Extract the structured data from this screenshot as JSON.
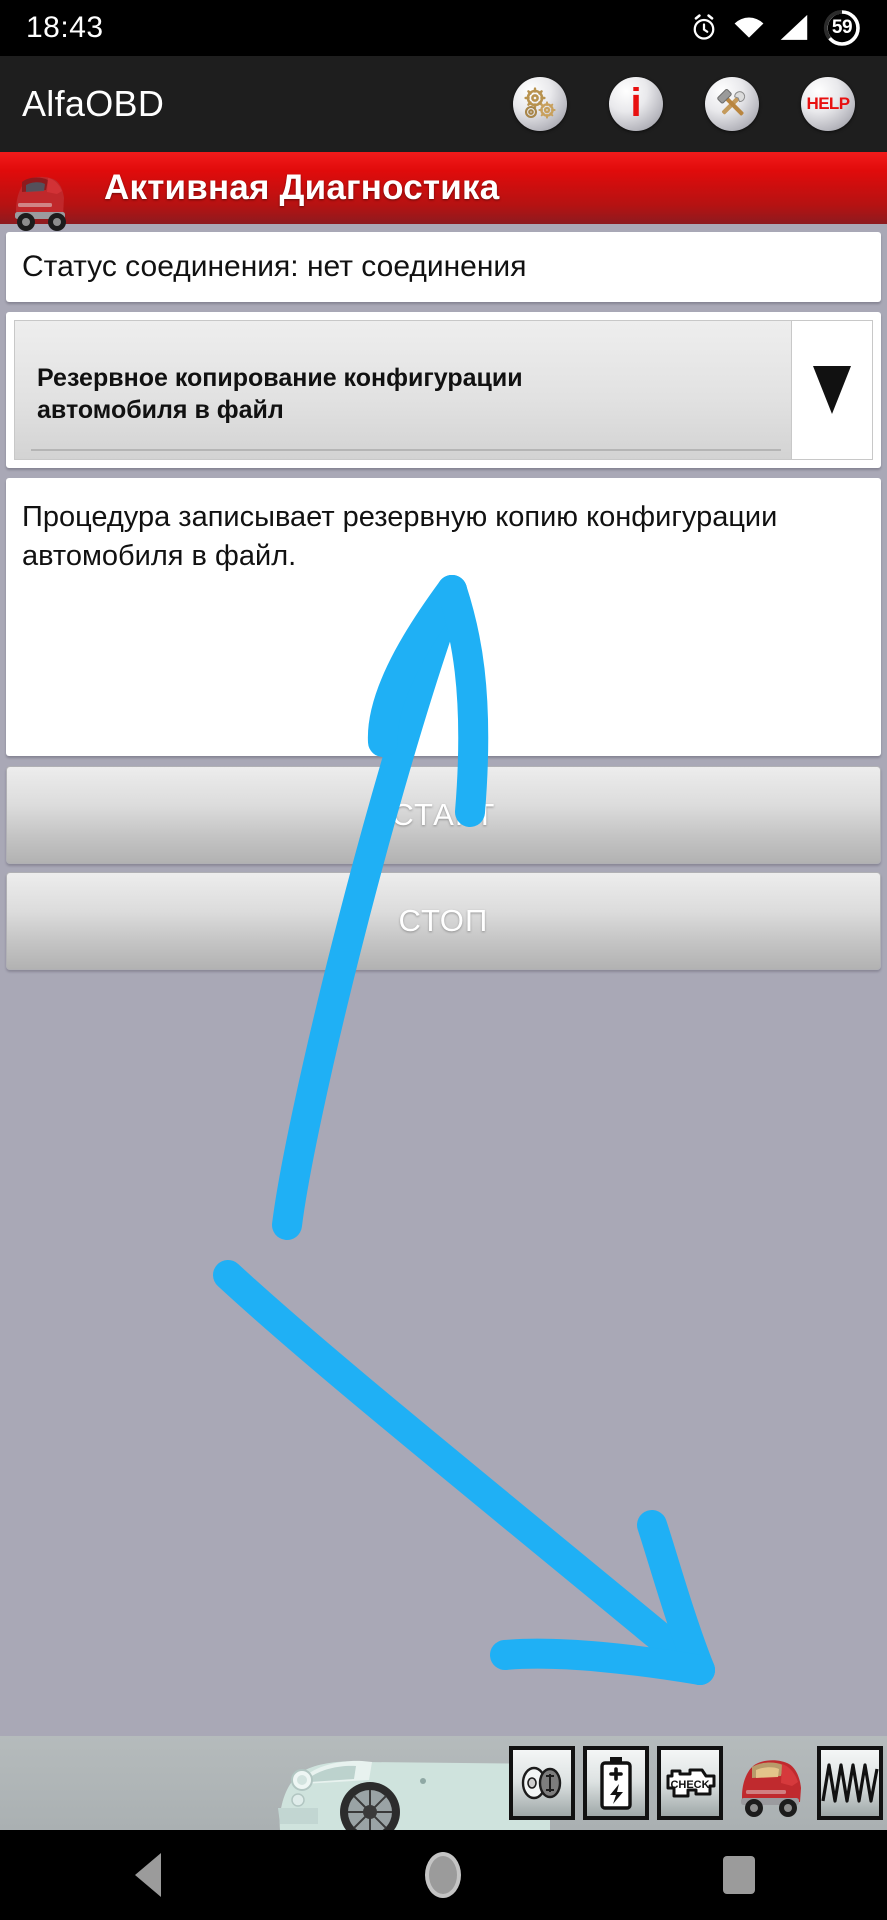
{
  "status_bar": {
    "time": "18:43",
    "icons": [
      "alarm-icon",
      "wifi-icon",
      "signal-icon"
    ],
    "battery_percent": "59"
  },
  "app_header": {
    "title": "AlfaOBD",
    "actions": [
      {
        "name": "gears-icon",
        "label": ""
      },
      {
        "name": "info-icon",
        "label": "i"
      },
      {
        "name": "tools-icon",
        "label": ""
      },
      {
        "name": "help-icon",
        "label": "HELP"
      }
    ]
  },
  "title_bar": {
    "title": "Активная Диагностика",
    "icon": "red-car-icon"
  },
  "main": {
    "connection_status": "Статус соединения: нет соединения",
    "procedure_select": {
      "value": "Резервное копирование конфигурации автомобиля в файл",
      "chevron": "chevron-down-icon"
    },
    "description": "Процедура записывает резервную копию конфигурации автомобиля в файл.",
    "start_label": "СТАРТ",
    "stop_label": "СТОП"
  },
  "bottom_toolbar": {
    "icons": [
      {
        "name": "lamp-icon",
        "label": ""
      },
      {
        "name": "battery-icon",
        "label": ""
      },
      {
        "name": "check-engine-icon",
        "label": "CHECK"
      },
      {
        "name": "red-car-icon",
        "label": ""
      },
      {
        "name": "waveform-icon",
        "label": ""
      }
    ]
  },
  "nav_bar": {
    "back": "back-icon",
    "home": "home-icon",
    "recents": "recents-icon"
  },
  "annotations": {
    "accent_color": "#1fb0f5",
    "arrows": [
      {
        "name": "arrow-to-description",
        "direction": "up-right"
      },
      {
        "name": "arrow-to-bottom-right",
        "direction": "down-right"
      }
    ]
  }
}
